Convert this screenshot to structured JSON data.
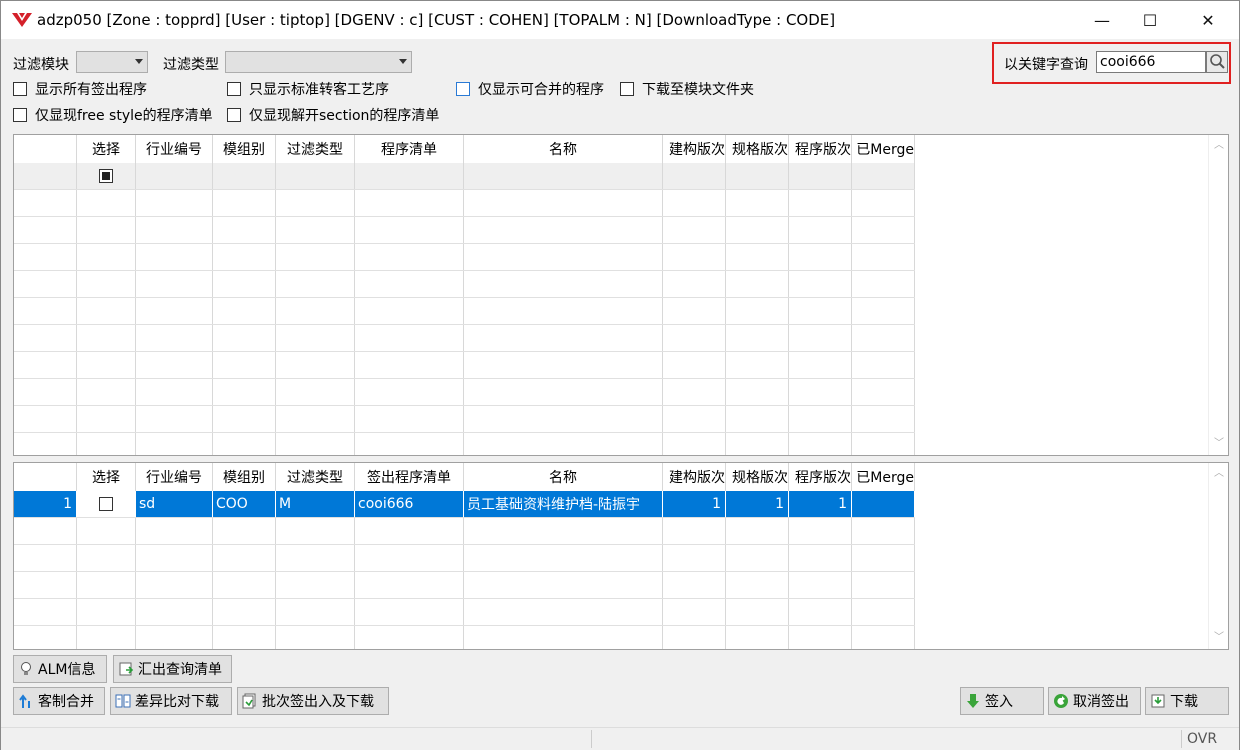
{
  "window": {
    "title": "adzp050 [Zone : topprd]  [User : tiptop]  [DGENV : c]  [CUST : COHEN]  [TOPALM : N]  [DownloadType : CODE]",
    "min_symbol": "—",
    "max_symbol": "☐",
    "close_symbol": "✕"
  },
  "filters": {
    "module_label": "过滤模块",
    "module_value": "",
    "type_label": "过滤类型",
    "type_value": ""
  },
  "search": {
    "label": "以关键字查询",
    "value": "cooi666"
  },
  "options": [
    {
      "label": "显示所有签出程序",
      "checked": false
    },
    {
      "label": "只显示标准转客工艺序",
      "checked": false
    },
    {
      "label": "仅显示可合并的程序",
      "checked": false
    },
    {
      "label": "下载至模块文件夹",
      "checked": false
    },
    {
      "label": "仅显现free style的程序清单",
      "checked": false
    },
    {
      "label": "仅显现解开section的程序清单",
      "checked": false
    }
  ],
  "top_grid": {
    "columns": [
      "",
      "选择",
      "行业编号",
      "模组别",
      "过滤类型",
      "程序清单",
      "名称",
      "建构版次",
      "规格版次",
      "程序版次",
      "已Merge"
    ]
  },
  "bottom_grid": {
    "columns": [
      "",
      "选择",
      "行业编号",
      "模组别",
      "过滤类型",
      "签出程序清单",
      "名称",
      "建构版次",
      "规格版次",
      "程序版次",
      "已Merge"
    ],
    "rows": [
      {
        "num": "1",
        "selected": false,
        "industry": "sd",
        "module": "COO",
        "filter_type": "M",
        "program": "cooi666",
        "name": "员工基础资料维护档-陆振宇",
        "build_ver": "1",
        "spec_ver": "1",
        "prog_ver": "1",
        "merged": ""
      }
    ]
  },
  "buttons": {
    "alm": "ALM信息",
    "export": "汇出查询清单",
    "custom_merge": "客制合并",
    "diff_download": "差异比对下载",
    "batch": "批次签出入及下载",
    "checkin": "签入",
    "cancel_checkout": "取消签出",
    "download": "下载"
  },
  "status": {
    "mode": "OVR"
  }
}
